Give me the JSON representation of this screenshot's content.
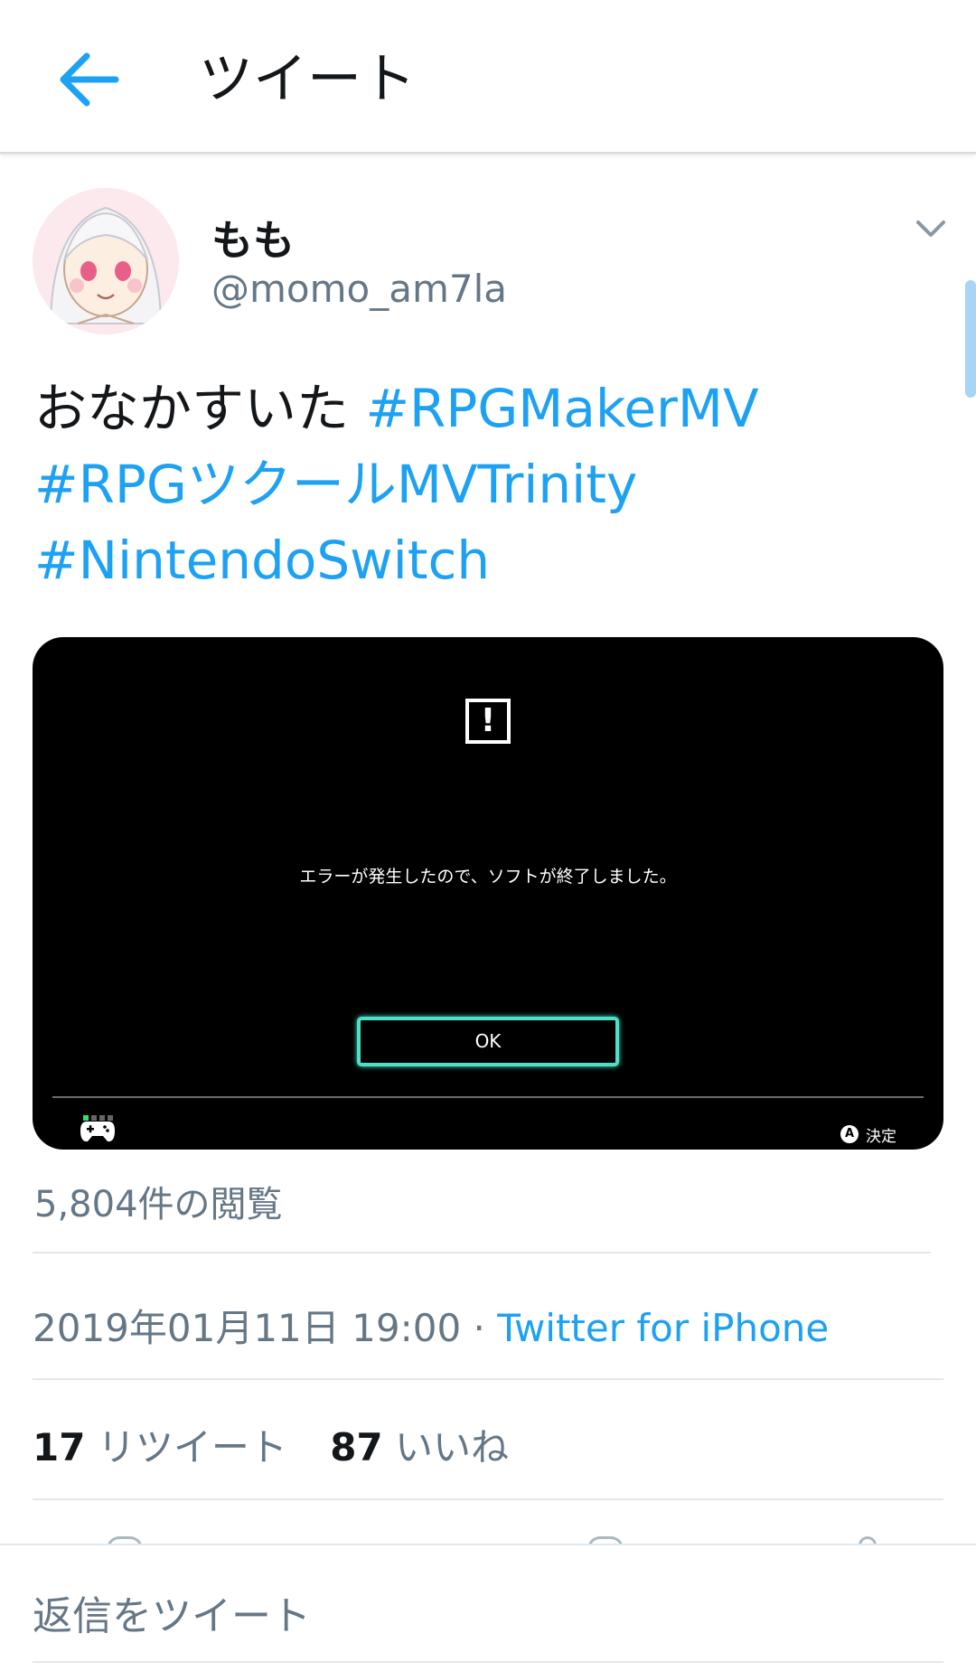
{
  "header": {
    "title": "ツイート",
    "back_icon": "arrow-left-icon"
  },
  "tweet": {
    "author": {
      "display_name": "もも",
      "handle": "@momo_am7la"
    },
    "text": "おなかすいた",
    "hashtags": [
      "#RPGMakerMV",
      "#RPGツクールMVTrinity",
      "#NintendoSwitch"
    ],
    "media": {
      "error_message": "エラーが発生したので、ソフトが終了しました。",
      "ok_label": "OK",
      "a_button_label": "A",
      "decide_label": "決定"
    },
    "views": "5,804件の閲覧",
    "timestamp": "2019年01月11日 19:00",
    "separator": " · ",
    "source": "Twitter for iPhone",
    "retweets": {
      "count": "17",
      "label": "リツイート"
    },
    "likes": {
      "count": "87",
      "label": "いいね"
    }
  },
  "reply": {
    "placeholder": "返信をツイート"
  },
  "colors": {
    "accent": "#1da1f2",
    "secondary_text": "#657786",
    "switch_ok_border": "#4de0c2"
  }
}
